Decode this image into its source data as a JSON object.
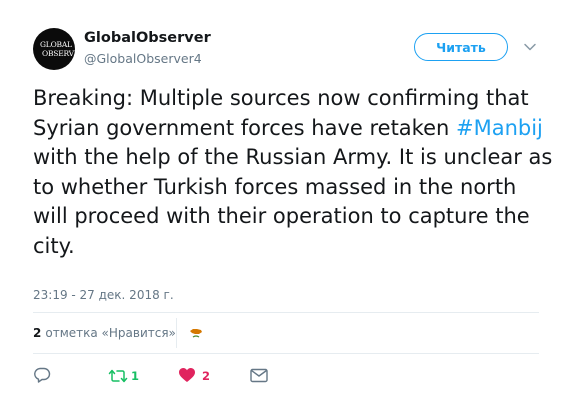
{
  "author": {
    "avatar_text_line1": "GLOBAL",
    "avatar_text_line2": "OBSERVER",
    "name": "GlobalObserver",
    "handle": "@GlobalObserver4"
  },
  "follow_button_label": "Читать",
  "tweet": {
    "text_before": "Breaking: Multiple sources now confirming that Syrian government forces have retaken ",
    "hashtag": "#Manbij",
    "text_after": " with the help of the Russian Army. It is unclear as to whether Turkish forces massed in the north will proceed with their operation to capture the city.",
    "timestamp": "23:19 - 27 дек. 2018 г."
  },
  "stats": {
    "likes_count": "2",
    "likes_label": "отметка «Нравится»"
  },
  "actions": {
    "retweet_count": "1",
    "like_count": "2"
  },
  "colors": {
    "accent": "#1da1f2",
    "retweet": "#17bf63",
    "like": "#e0245e",
    "muted": "#657786"
  },
  "icons": [
    "chevron-down-icon",
    "reply-icon",
    "retweet-icon",
    "heart-icon",
    "direct-message-icon",
    "cyprus-flag-avatar-icon"
  ]
}
